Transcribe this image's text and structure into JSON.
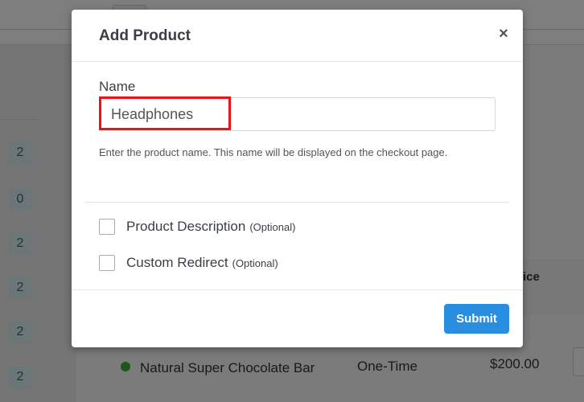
{
  "background": {
    "badges": [
      "2",
      "0",
      "2",
      "2",
      "2",
      "2"
    ],
    "table_header_partial": "ice",
    "row": {
      "product": "Natural Super Chocolate Bar",
      "type": "One-Time",
      "price": "$200.00",
      "status_color": "#3cae3c"
    }
  },
  "modal": {
    "title": "Add Product",
    "close_label": "×",
    "name_label": "Name",
    "name_value": "Headphones",
    "name_help": "Enter the product name. This name will be displayed on the checkout page.",
    "options": [
      {
        "label": "Product Description",
        "optional": "(Optional)"
      },
      {
        "label": "Custom Redirect",
        "optional": "(Optional)"
      }
    ],
    "submit_label": "Submit",
    "highlight_color": "#e8141a",
    "accent_color": "#2a8ee0"
  }
}
